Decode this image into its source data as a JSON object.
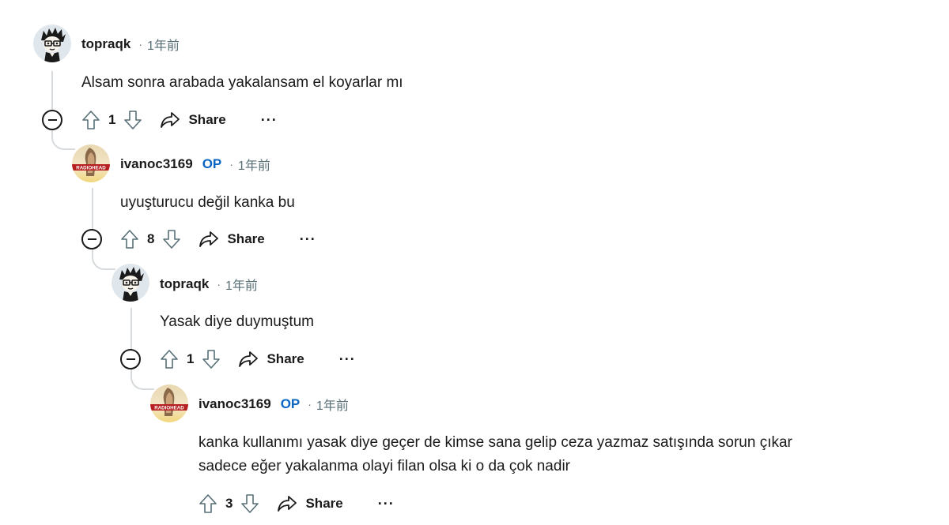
{
  "comments": [
    {
      "username": "topraqk",
      "op_badge": "",
      "time": "1年前",
      "body_lines": [
        "Alsam sonra arabada yakalansam el koyarlar mı"
      ],
      "score": "1",
      "share_label": "Share",
      "more_label": "···",
      "avatar": "cartoon-avatar"
    },
    {
      "username": "ivanoc3169",
      "op_badge": "OP",
      "time": "1年前",
      "body_lines": [
        "uyuşturucu değil kanka bu"
      ],
      "score": "8",
      "share_label": "Share",
      "more_label": "···",
      "avatar": "radiohead-avatar"
    },
    {
      "username": "topraqk",
      "op_badge": "",
      "time": "1年前",
      "body_lines": [
        "Yasak diye duymuştum"
      ],
      "score": "1",
      "share_label": "Share",
      "more_label": "···",
      "avatar": "cartoon-avatar"
    },
    {
      "username": "ivanoc3169",
      "op_badge": "OP",
      "time": "1年前",
      "body_lines": [
        "kanka kullanımı yasak diye geçer de kimse sana gelip ceza yazmaz satışında sorun çıkar",
        "sadece eğer yakalanma olayi filan olsa ki o da çok nadir"
      ],
      "score": "3",
      "share_label": "Share",
      "more_label": "···",
      "avatar": "radiohead-avatar"
    }
  ],
  "avatar_text": "RADIOHEAD",
  "separator": "·",
  "colors": {
    "op_badge": "#0a66c2",
    "thread_line": "#d7dbde",
    "meta_text": "#576f76"
  }
}
